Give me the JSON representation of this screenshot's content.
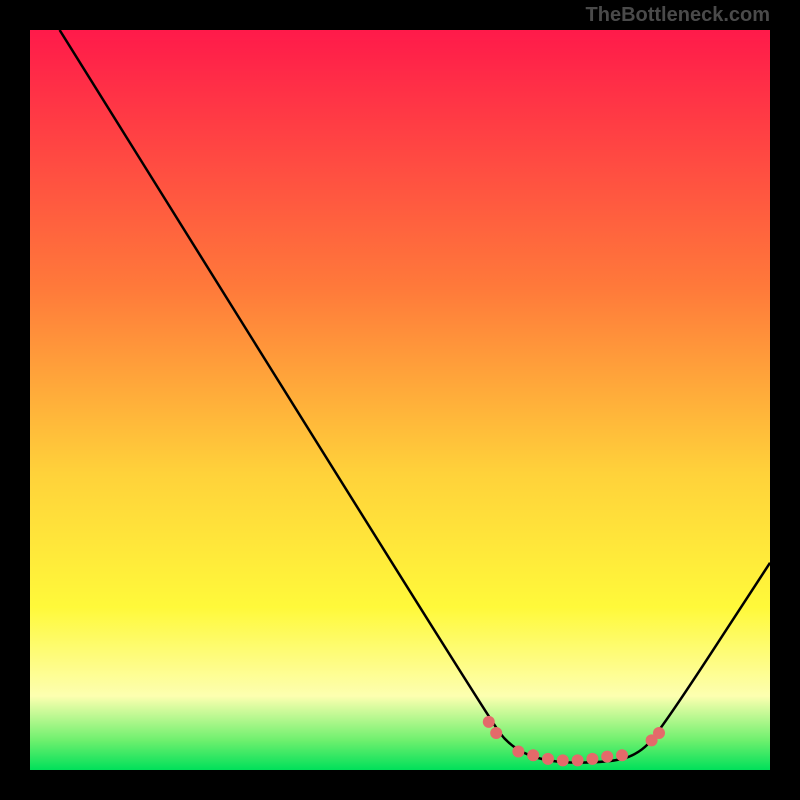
{
  "watermark": "TheBottleneck.com",
  "chart_data": {
    "type": "line",
    "title": "",
    "xlabel": "",
    "ylabel": "",
    "xlim": [
      0,
      100
    ],
    "ylim": [
      0,
      100
    ],
    "background": {
      "type": "vertical-gradient",
      "stops": [
        {
          "offset": 0,
          "color": "#ff1a4a"
        },
        {
          "offset": 35,
          "color": "#ff7a3a"
        },
        {
          "offset": 60,
          "color": "#ffd23a"
        },
        {
          "offset": 78,
          "color": "#fff93a"
        },
        {
          "offset": 90,
          "color": "#fdffb0"
        },
        {
          "offset": 96,
          "color": "#6ef06e"
        },
        {
          "offset": 100,
          "color": "#00e05a"
        }
      ]
    },
    "series": [
      {
        "name": "bottleneck-curve",
        "color": "#000000",
        "points": [
          {
            "x": 4,
            "y": 100
          },
          {
            "x": 62,
            "y": 7
          },
          {
            "x": 65,
            "y": 3
          },
          {
            "x": 70,
            "y": 1
          },
          {
            "x": 78,
            "y": 1
          },
          {
            "x": 82,
            "y": 2
          },
          {
            "x": 85,
            "y": 5
          },
          {
            "x": 100,
            "y": 28
          }
        ]
      }
    ],
    "markers": [
      {
        "name": "highlight-dots",
        "color": "#e46a6a",
        "points": [
          {
            "x": 62,
            "y": 6.5
          },
          {
            "x": 63,
            "y": 5
          },
          {
            "x": 66,
            "y": 2.5
          },
          {
            "x": 68,
            "y": 2
          },
          {
            "x": 70,
            "y": 1.5
          },
          {
            "x": 72,
            "y": 1.3
          },
          {
            "x": 74,
            "y": 1.3
          },
          {
            "x": 76,
            "y": 1.5
          },
          {
            "x": 78,
            "y": 1.8
          },
          {
            "x": 80,
            "y": 2
          },
          {
            "x": 84,
            "y": 4
          },
          {
            "x": 85,
            "y": 5
          }
        ]
      }
    ]
  }
}
